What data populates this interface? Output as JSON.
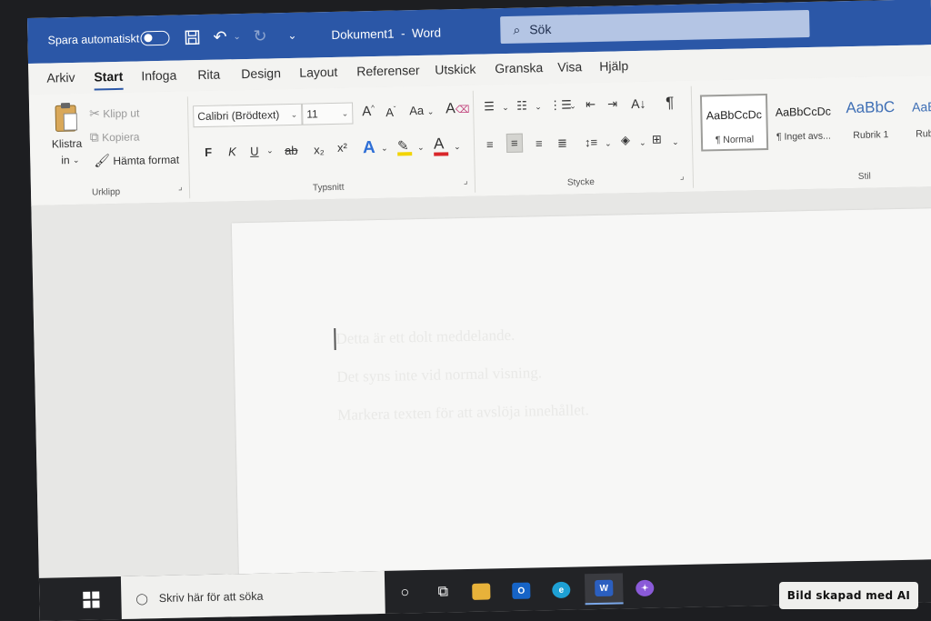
{
  "titlebar": {
    "autosave_label": "Spara automatiskt",
    "doc_title": "Dokument1",
    "separator": "-",
    "app_name": "Word",
    "search_placeholder": "Sök"
  },
  "tabs": [
    "Arkiv",
    "Start",
    "Infoga",
    "Rita",
    "Design",
    "Layout",
    "Referenser",
    "Utskick",
    "Granska",
    "Visa",
    "Hjälp"
  ],
  "active_tab": "Start",
  "clipboard": {
    "paste_label": "Klistra",
    "paste_label2": "in",
    "cut_label": "Klipp ut",
    "copy_label": "Kopiera",
    "format_painter_label": "Hämta format",
    "group_label": "Urklipp"
  },
  "font": {
    "font_name": "Calibri (Brödtext)",
    "font_size": "11",
    "grow": "A^",
    "shrink": "A˅",
    "change_case": "Aa",
    "bold": "F",
    "italic": "K",
    "underline": "U",
    "strike": "ab",
    "subscript": "x₂",
    "superscript": "x²",
    "text_effects": "A",
    "highlight": "✎",
    "font_color": "A",
    "group_label": "Typsnitt"
  },
  "paragraph": {
    "group_label": "Stycke",
    "pilcrow": "¶"
  },
  "styles": {
    "items": [
      {
        "sample": "AaBbCcDc",
        "name": "¶ Normal"
      },
      {
        "sample": "AaBbCcDc",
        "name": "¶ Inget avs..."
      },
      {
        "sample": "AaBbC",
        "name": "Rubrik 1"
      },
      {
        "sample": "AaB",
        "name": "Rub"
      }
    ],
    "group_label": "Stil"
  },
  "document": {
    "lines": [
      "Detta är ett dolt meddelande.",
      "Det syns inte vid normal visning.",
      "Markera texten för att avslöja innehållet."
    ]
  },
  "taskbar": {
    "search_placeholder": "Skriv här för att söka",
    "apps": [
      "cortana",
      "task-view",
      "file-explorer",
      "outlook",
      "edge",
      "word",
      "copilot"
    ]
  },
  "badge": {
    "text": "Bild skapad med AI"
  },
  "colors": {
    "title_bar": "#2b57a7",
    "highlight_yellow": "#f2d400",
    "font_color_red": "#d9262a",
    "text_effects_blue": "#2f6fd6"
  }
}
